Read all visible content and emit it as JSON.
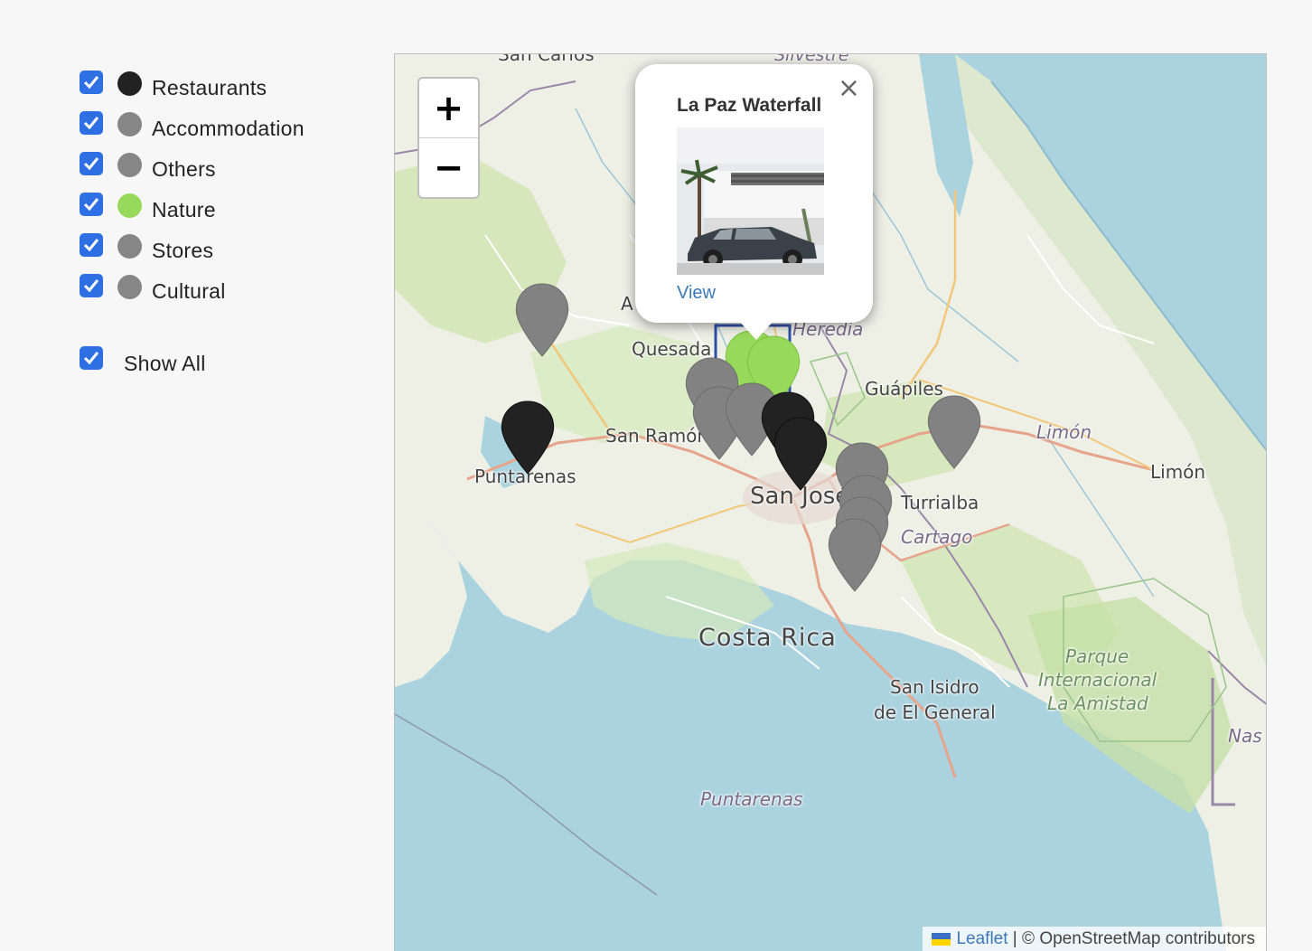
{
  "filters": [
    {
      "label": "Restaurants",
      "color": "#222222",
      "checked": true
    },
    {
      "label": "Accommodation",
      "color": "#868686",
      "checked": true
    },
    {
      "label": "Others",
      "color": "#868686",
      "checked": true
    },
    {
      "label": "Nature",
      "color": "#97d95a",
      "checked": true
    },
    {
      "label": "Stores",
      "color": "#868686",
      "checked": true
    },
    {
      "label": "Cultural",
      "color": "#868686",
      "checked": true
    }
  ],
  "show_all": {
    "label": "Show All",
    "checked": true
  },
  "map": {
    "zoom_in": "+",
    "zoom_out": "−",
    "places": {
      "san_carlos": "San Carlos",
      "silvestre": "Silvestre",
      "quesada": "Quesada",
      "heredia": "Heredia",
      "guapiles": "Guápiles",
      "limon_province": "Limón",
      "limon_city": "Limón",
      "san_ramon": "San Ramón",
      "puntarenas_city": "Puntarenas",
      "san_jose": "San José",
      "turrialba": "Turrialba",
      "cartago": "Cartago",
      "costa_rica": "Costa Rica",
      "san_isidro_line1": "San Isidro",
      "san_isidro_line2": "de El General",
      "parque_line1": "Parque",
      "parque_line2": "Internacional",
      "parque_line3": "La Amistad",
      "puntarenas_province": "Puntarenas",
      "nas": "Nas",
      "a_fragment": "A"
    },
    "popup": {
      "title": "La Paz Waterfall",
      "link": "View",
      "close_icon": "×"
    },
    "attribution": {
      "leaflet": "Leaflet",
      "separator": " | © ",
      "osm": "OpenStreetMap contributors"
    }
  }
}
